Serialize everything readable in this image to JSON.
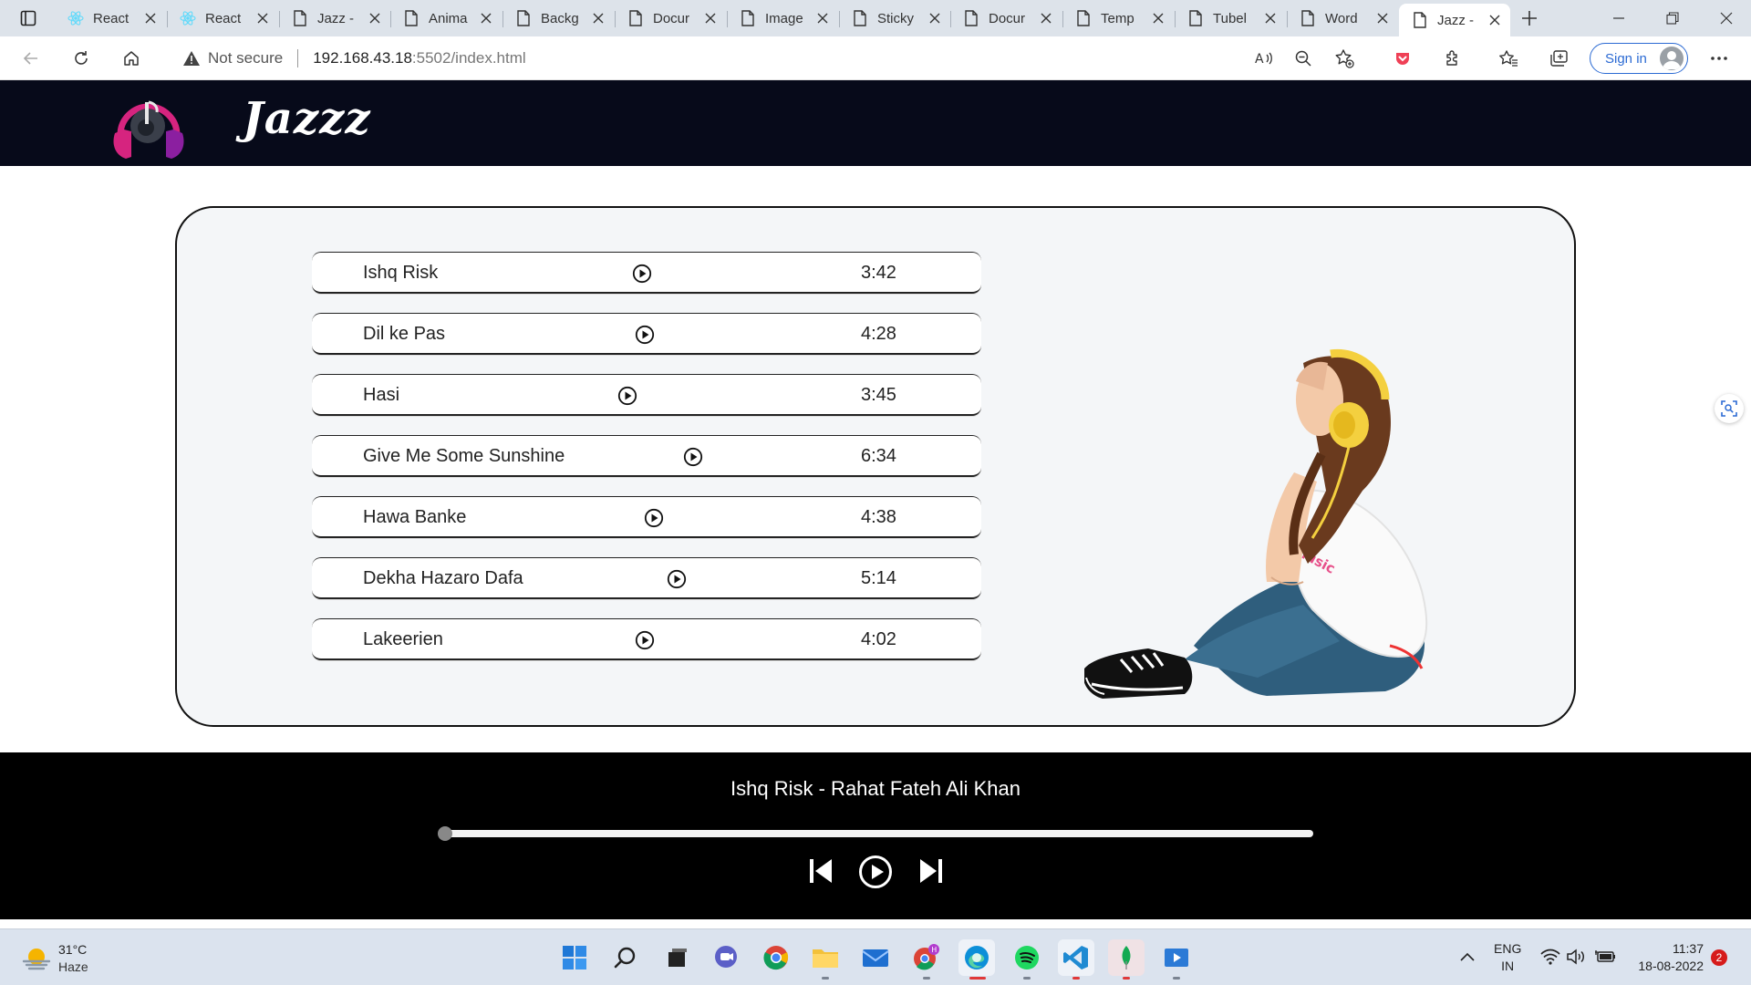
{
  "browser": {
    "tabs": [
      {
        "title": "React",
        "favicon": "react-icon"
      },
      {
        "title": "React",
        "favicon": "react-icon"
      },
      {
        "title": "Jazz -",
        "favicon": "page-icon"
      },
      {
        "title": "Anima",
        "favicon": "page-icon"
      },
      {
        "title": "Backg",
        "favicon": "page-icon"
      },
      {
        "title": "Docur",
        "favicon": "page-icon"
      },
      {
        "title": "Image",
        "favicon": "page-icon"
      },
      {
        "title": "Sticky",
        "favicon": "page-icon"
      },
      {
        "title": "Docur",
        "favicon": "page-icon"
      },
      {
        "title": "Temp",
        "favicon": "page-icon"
      },
      {
        "title": "Tubel",
        "favicon": "page-icon"
      },
      {
        "title": "Word",
        "favicon": "page-icon"
      },
      {
        "title": "Jazz -",
        "favicon": "page-icon",
        "active": true
      }
    ],
    "address": {
      "security": "Not secure",
      "host": "192.168.43.18",
      "path": ":5502/index.html"
    },
    "signin_label": "Sign in"
  },
  "site": {
    "brand": "Jazzz",
    "songs": [
      {
        "name": "Ishq Risk",
        "duration": "3:42"
      },
      {
        "name": "Dil ke Pas",
        "duration": "4:28"
      },
      {
        "name": "Hasi",
        "duration": "3:45"
      },
      {
        "name": "Give Me Some Sunshine",
        "duration": "6:34"
      },
      {
        "name": "Hawa Banke",
        "duration": "4:38"
      },
      {
        "name": "Dekha Hazaro Dafa",
        "duration": "5:14"
      },
      {
        "name": "Lakeerien",
        "duration": "4:02"
      }
    ],
    "illustration_text": "music",
    "player": {
      "now_playing": "Ishq Risk - Rahat Fateh Ali Khan",
      "progress": 0.0,
      "controls": [
        "previous-icon",
        "play-icon",
        "next-icon"
      ]
    }
  },
  "taskbar": {
    "weather": {
      "temp": "31°C",
      "condition": "Haze"
    },
    "apps": [
      "start-icon",
      "search-icon",
      "task-view-icon",
      "teams-chat-icon",
      "chrome-icon",
      "file-explorer-icon",
      "mail-icon",
      "chrome-profile-icon",
      "edge-icon",
      "spotify-icon",
      "vscode-icon",
      "mongodb-compass-icon",
      "video-editor-icon"
    ],
    "lang": {
      "line1": "ENG",
      "line2": "IN"
    },
    "clock": {
      "time": "11:37",
      "date": "18-08-2022"
    },
    "notifications": "2"
  },
  "colors": {
    "header_bg": "#070a1a",
    "player_bg": "#000000",
    "card_bg": "#f4f6f8",
    "logo_accent": "#d6247f",
    "taskbar_bg": "#dbe3ee",
    "link_blue": "#2b6ad3"
  }
}
